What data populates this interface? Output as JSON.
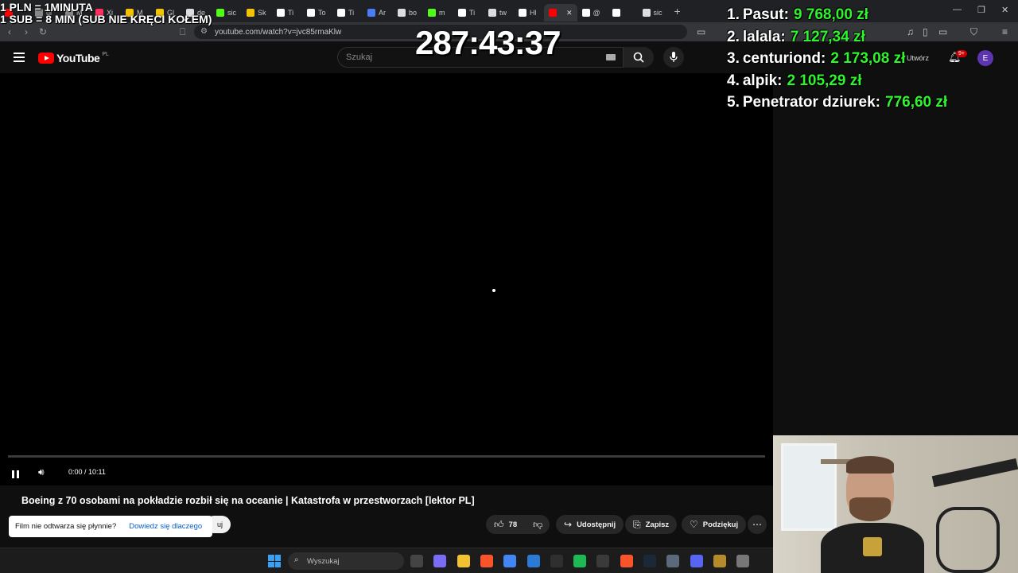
{
  "browser": {
    "tabs": [
      {
        "label": "",
        "icon": "youtube-favicon",
        "color": "#ff0000"
      },
      {
        "label": "ul",
        "icon": "generic-favicon",
        "color": "#888888"
      },
      {
        "label": "M",
        "icon": "generic-favicon",
        "color": "#888888"
      },
      {
        "label": "Xi",
        "icon": "tiktok-favicon",
        "color": "#ff2f5f"
      },
      {
        "label": "M",
        "icon": "play-favicon",
        "color": "#f5c400"
      },
      {
        "label": "Gl",
        "icon": "play-favicon",
        "color": "#f5c400"
      },
      {
        "label": "de",
        "icon": "google-favicon",
        "color": "#dddddd"
      },
      {
        "label": "sic",
        "icon": "kick-favicon",
        "color": "#53fc18"
      },
      {
        "label": "Sk",
        "icon": "doc-favicon",
        "color": "#f5c400"
      },
      {
        "label": "Ti",
        "icon": "tiktok-favicon",
        "color": "#ffffff"
      },
      {
        "label": "To",
        "icon": "tiktok-favicon",
        "color": "#ffffff"
      },
      {
        "label": "Ti",
        "icon": "tiktok-favicon",
        "color": "#ffffff"
      },
      {
        "label": "Ar",
        "icon": "translate-favicon",
        "color": "#4a7df7"
      },
      {
        "label": "bo",
        "icon": "google-favicon",
        "color": "#dddddd"
      },
      {
        "label": "m",
        "icon": "kick-favicon",
        "color": "#53fc18"
      },
      {
        "label": "Ti",
        "icon": "tiktok-favicon",
        "color": "#ffffff"
      },
      {
        "label": "tw",
        "icon": "google-favicon",
        "color": "#dddddd"
      },
      {
        "label": "Hl",
        "icon": "x-favicon",
        "color": "#ffffff"
      },
      {
        "label": "",
        "icon": "youtube-favicon",
        "color": "#ff0000",
        "active": true
      },
      {
        "label": "@",
        "icon": "tiktok-favicon",
        "color": "#ffffff"
      },
      {
        "label": "",
        "icon": "x-favicon",
        "color": "#ffffff"
      },
      {
        "label": "sic",
        "icon": "google-favicon",
        "color": "#dddddd"
      }
    ],
    "new_tab": "+",
    "url": "youtube.com/watch?v=jvc85rmaKlw"
  },
  "youtube": {
    "logo_text": "YouTube",
    "country": "PL",
    "search_placeholder": "Szukaj",
    "create_label": "Utwórz",
    "notification_badge": "9+",
    "avatar_letter": "E",
    "video": {
      "time": "0:00 / 10:11",
      "progress": 0.0,
      "title": "Boeing z 70 osobami na pokładzie rozbił się na oceanie | Katastrofa w przestworzach [lektor PL]"
    },
    "toast": {
      "message": "Film nie odtwarza się płynnie?",
      "link": "Dowiedz się dlaczego"
    },
    "subscribe_partial": "uj",
    "actions": {
      "likes": "78",
      "share": "Udostępnij",
      "save": "Zapisz",
      "thanks": "Podziękuj"
    }
  },
  "taskbar": {
    "search_placeholder": "Wyszukaj",
    "apps": [
      {
        "name": "task-view",
        "color": "#444444"
      },
      {
        "name": "copilot",
        "color": "#7b6cf6"
      },
      {
        "name": "file-explorer",
        "color": "#f2c230"
      },
      {
        "name": "brave",
        "color": "#fb542b"
      },
      {
        "name": "chrome",
        "color": "#4285f4"
      },
      {
        "name": "store",
        "color": "#2b7bd6"
      },
      {
        "name": "obs",
        "color": "#302e31"
      },
      {
        "name": "spotify",
        "color": "#1db954"
      },
      {
        "name": "media-app",
        "color": "#3a3a3a"
      },
      {
        "name": "brave-alt",
        "color": "#fb542b"
      },
      {
        "name": "steam",
        "color": "#1b2838"
      },
      {
        "name": "calculator",
        "color": "#5a6a7a"
      },
      {
        "name": "discord",
        "color": "#5865f2"
      },
      {
        "name": "league",
        "color": "#b58a2b"
      },
      {
        "name": "settings",
        "color": "#777777"
      }
    ]
  },
  "overlay": {
    "rate_line_1": "1 PLN = 1MINUTA",
    "rate_line_2": "1 SUB = 8 MIN (SUB NIE KRĘCI KOŁEM)",
    "timer": "287:43:37",
    "leaderboard": [
      {
        "rank": "1.",
        "name": "Pasut:",
        "amount": "9 768,00 zł"
      },
      {
        "rank": "2.",
        "name": "lalala:",
        "amount": "7 127,34 zł"
      },
      {
        "rank": "3.",
        "name": "centuriond:",
        "amount": "2 173,08 zł"
      },
      {
        "rank": "4.",
        "name": "alpik:",
        "amount": "2 105,29 zł"
      },
      {
        "rank": "5.",
        "name": "Penetrator dziurek:",
        "amount": "776,60 zł"
      }
    ]
  }
}
